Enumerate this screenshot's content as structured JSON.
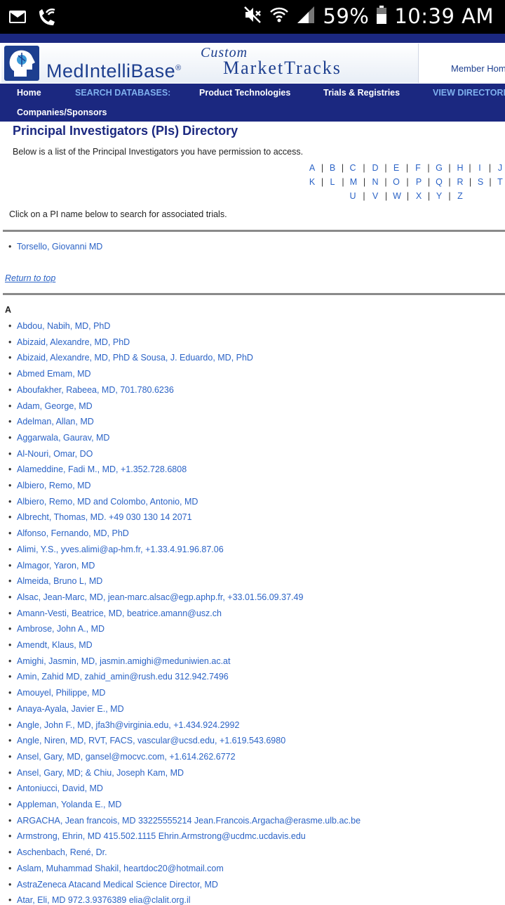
{
  "status_bar": {
    "battery": "59%",
    "time": "10:39 AM",
    "icons": [
      "gmail-icon",
      "wifi-calling-icon",
      "mute-icon",
      "wifi-icon",
      "signal-icon",
      "battery-icon"
    ]
  },
  "header": {
    "brand": "MedIntelliBase",
    "registered": "®",
    "custom": "Custom",
    "market_tracks": "MarketTracks",
    "member_home": "Member Hom"
  },
  "nav": {
    "home": "Home",
    "search_databases": "SEARCH DATABASES:",
    "product_technologies": "Product Technologies",
    "trials_registries": "Trials & Registries",
    "view_directories": "VIEW DIRECTORIE",
    "companies_sponsors": "Companies/Sponsors"
  },
  "page": {
    "title": "Principal Investigators (PIs) Directory",
    "intro": "Below is a list of the Principal Investigators you have permission to access.",
    "click_text": "Click on a PI name below to search for associated trials.",
    "return_to_top": "Return to top",
    "section_letter": "A"
  },
  "alphabet": {
    "row1": [
      "A",
      "B",
      "C",
      "D",
      "E",
      "F",
      "G",
      "H",
      "I",
      "J"
    ],
    "row2": [
      "K",
      "L",
      "M",
      "N",
      "O",
      "P",
      "Q",
      "R",
      "S",
      "T"
    ],
    "row3": [
      "U",
      "V",
      "W",
      "X",
      "Y",
      "Z"
    ],
    "separator": "|",
    "bullet": "•"
  },
  "featured_pi": "Torsello, Giovanni MD",
  "pi_list": [
    "Abdou, Nabih, MD, PhD",
    "Abizaid, Alexandre, MD, PhD",
    "Abizaid, Alexandre, MD, PhD & Sousa, J. Eduardo, MD, PhD",
    "Abmed Emam, MD",
    "Aboufakher, Rabeea, MD, 701.780.6236",
    "Adam, George, MD",
    "Adelman, Allan, MD",
    "Aggarwala, Gaurav, MD",
    "Al-Nouri, Omar, DO",
    "Alameddine, Fadi M., MD, +1.352.728.6808",
    "Albiero, Remo, MD",
    "Albiero, Remo, MD and Colombo, Antonio, MD",
    "Albrecht, Thomas, MD. +49 030 130 14 2071",
    "Alfonso, Fernando, MD, PhD",
    "Alimi, Y.S., yves.alimi@ap-hm.fr, +1.33.4.91.96.87.06",
    "Almagor, Yaron, MD",
    "Almeida, Bruno L, MD",
    "Alsac, Jean-Marc, MD, jean-marc.alsac@egp.aphp.fr, +33.01.56.09.37.49",
    "Amann-Vesti, Beatrice, MD, beatrice.amann@usz.ch",
    "Ambrose, John A., MD",
    "Amendt, Klaus, MD",
    "Amighi, Jasmin, MD, jasmin.amighi@meduniwien.ac.at",
    "Amin, Zahid MD, zahid_amin@rush.edu 312.942.7496",
    "Amouyel, Philippe, MD",
    "Anaya-Ayala, Javier E., MD",
    "Angle, John F., MD, jfa3h@virginia.edu, +1.434.924.2992",
    "Angle, Niren, MD, RVT, FACS, vascular@ucsd.edu, +1.619.543.6980",
    "Ansel, Gary, MD, gansel@mocvc.com, +1.614.262.6772",
    "Ansel, Gary, MD; & Chiu, Joseph Kam, MD",
    "Antoniucci, David, MD",
    "Appleman, Yolanda E., MD",
    "ARGACHA, Jean francois, MD 33225555214 Jean.Francois.Argacha@erasme.ulb.ac.be",
    "Armstrong, Ehrin, MD 415.502.1115 Ehrin.Armstrong@ucdmc.ucdavis.edu",
    "Aschenbach, René, Dr.",
    "Aslam, Muhammad Shakil, heartdoc20@hotmail.com",
    "AstraZeneca Atacand Medical Science Director, MD",
    "Atar, Eli, MD 972.3.9376389 elia@clalit.org.il"
  ]
}
